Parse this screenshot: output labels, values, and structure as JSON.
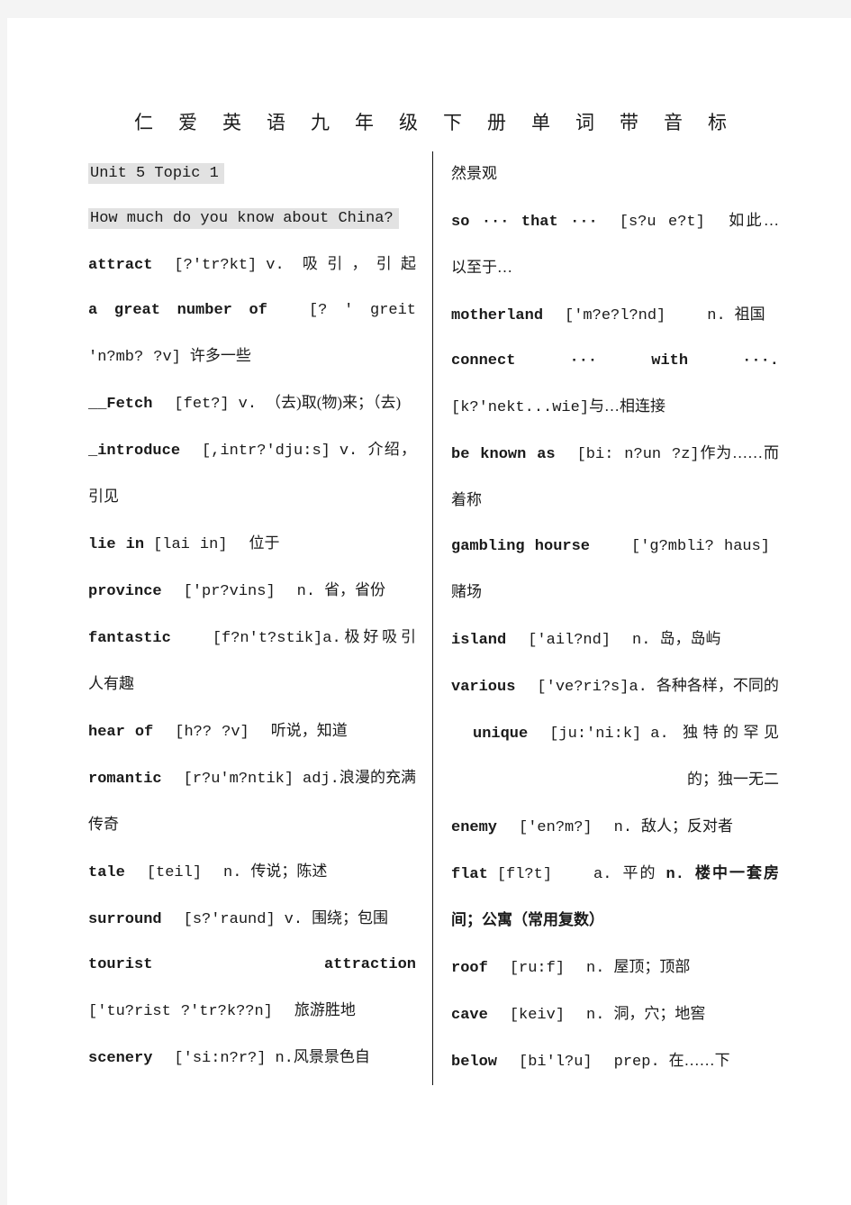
{
  "document": {
    "title_chars": [
      "仁",
      "爱",
      "英",
      "语",
      "九",
      "年",
      "级",
      "下",
      "册",
      "单",
      "词",
      "带",
      "音",
      "标"
    ],
    "title_full": "仁爱英语九年级下册单词带音标",
    "highlight_color": "#e2e2e2",
    "page_background": "#ffffff",
    "canvas_background": "#f4f4f4"
  },
  "left_column": {
    "unit_heading": "Unit 5 Topic 1",
    "topic_heading": "How much do you know about China?",
    "entries": [
      {
        "word": "attract",
        "ipa": "[?'tr?kt]",
        "pos": "v.",
        "cn": "吸引，引起"
      },
      {
        "word": "a great number of",
        "ipa": "[? ' greit 'n?mb? ?v]",
        "pos": "",
        "cn": "许多一些"
      },
      {
        "word": "__Fetch",
        "ipa": "[fet?]",
        "pos": "v.",
        "cn": "（去)取(物)来；（去)"
      },
      {
        "word": "_introduce",
        "ipa": "[,intr?'dju:s]",
        "pos": "v.",
        "cn": "介绍，引见"
      },
      {
        "word": "lie in",
        "ipa": "[lai in]",
        "pos": "",
        "cn": "位于"
      },
      {
        "word": "province",
        "ipa": "['pr?vins]",
        "pos": "n.",
        "cn": "省，省份"
      },
      {
        "word": "fantastic",
        "ipa": "[f?n't?stik]",
        "pos": "a.",
        "cn": "极好吸引人有趣"
      },
      {
        "word": "hear of",
        "ipa": "[h?? ?v]",
        "pos": "",
        "cn": "听说，知道"
      },
      {
        "word": "romantic",
        "ipa": "[r?u'm?ntik]",
        "pos": "adj.",
        "cn": "浪漫的充满传奇"
      },
      {
        "word": "tale",
        "ipa": "[teil]",
        "pos": "n.",
        "cn": "传说；陈述"
      },
      {
        "word": "surround",
        "ipa": "[s?'raund]",
        "pos": "v.",
        "cn": "围绕；包围"
      },
      {
        "word": "tourist attraction",
        "ipa": "['tu?rist ?'tr?k??n]",
        "pos": "",
        "cn": "旅游胜地"
      },
      {
        "word": "scenery",
        "ipa": "['si:n?r?]",
        "pos": "n.",
        "cn": "风景景色自"
      }
    ]
  },
  "right_column": {
    "continuation_text": "然景观",
    "entries": [
      {
        "word": "so ··· that ···",
        "ipa": "[s?u e?t]",
        "pos": "",
        "cn": "如此…以至于…"
      },
      {
        "word": "motherland",
        "ipa": "['m?e?l?nd]",
        "pos": "n.",
        "cn": "祖国"
      },
      {
        "word": "connect ··· with ···.",
        "ipa": "[k?'nekt...wie]",
        "pos": "",
        "cn": "与…相连接"
      },
      {
        "word": "be known as",
        "ipa": "[bi: n?un ?z]",
        "pos": "",
        "cn": "作为……而着称"
      },
      {
        "word": "gambling hourse",
        "ipa": "['g?mbli? haus]",
        "pos": "",
        "cn": "赌场"
      },
      {
        "word": "island",
        "ipa": "['ail?nd]",
        "pos": "n.",
        "cn": "岛，岛屿"
      },
      {
        "word": "various",
        "ipa": "['ve?ri?s]",
        "pos": "a.",
        "cn": "各种各样，不同的"
      },
      {
        "word": "unique",
        "ipa": "[ju:'ni:k]",
        "pos": "a.",
        "cn": "独特的罕见的；独一无二"
      },
      {
        "word": "enemy",
        "ipa": "['en?m?]",
        "pos": "n.",
        "cn": "敌人；反对者"
      },
      {
        "word": "flat",
        "ipa": "[fl?t]",
        "pos": "a.",
        "cn": "平的",
        "pos2": "n.",
        "cn2": "楼中一套房间；公寓（常用复数）"
      },
      {
        "word": "roof",
        "ipa": "[ru:f]",
        "pos": "n.",
        "cn": "屋顶；顶部"
      },
      {
        "word": "cave",
        "ipa": "[keiv]",
        "pos": "n.",
        "cn": "洞，穴；地窖"
      },
      {
        "word": "below",
        "ipa": "[bi'l?u]",
        "pos": "prep.",
        "cn": "在……下"
      }
    ]
  }
}
